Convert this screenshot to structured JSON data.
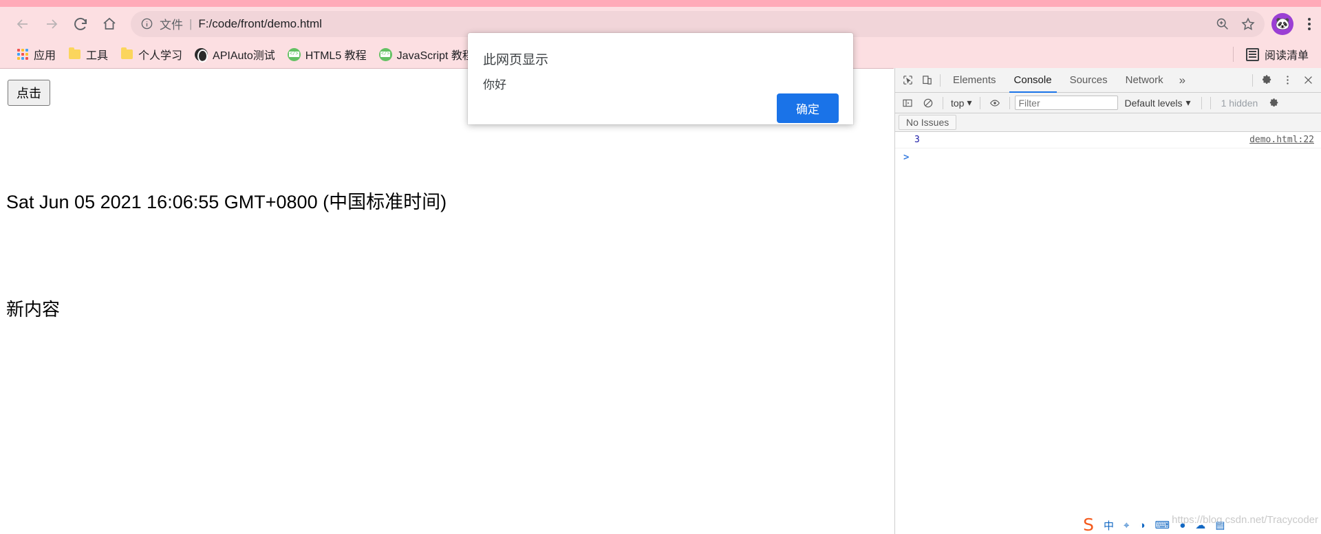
{
  "browser": {
    "nav": {
      "back_icon": "arrow-left-icon",
      "forward_icon": "arrow-right-icon",
      "reload_icon": "reload-icon",
      "home_icon": "home-icon"
    },
    "omnibox": {
      "info_icon": "info-circle-icon",
      "scheme_label": "文件",
      "separator": "|",
      "url": "F:/code/front/demo.html",
      "zoom_icon": "zoom-in-icon",
      "bookmark_icon": "star-icon"
    },
    "profile": {
      "avatar_icon": "panda-avatar",
      "avatar_glyph": "🐼",
      "color": "#9b3fd4"
    },
    "menu_icon": "kebab-menu-icon"
  },
  "bookmarks": {
    "items": [
      {
        "label": "应用",
        "icon": "apps-grid-icon"
      },
      {
        "label": "工具",
        "icon": "folder-icon"
      },
      {
        "label": "个人学习",
        "icon": "folder-icon"
      },
      {
        "label": "APIAuto测试",
        "icon": "globe-icon"
      },
      {
        "label": "HTML5 教程",
        "icon": "code-page-icon"
      },
      {
        "label": "JavaScript 教程",
        "icon": "code-page-icon"
      }
    ],
    "reading_list": {
      "label": "阅读清单",
      "icon": "reading-list-icon"
    }
  },
  "page": {
    "button_label": "点击",
    "date_text": "Sat Jun 05 2021 16:06:55 GMT+0800 (中国标准时间)",
    "new_content": "新内容"
  },
  "dialog": {
    "title": "此网页显示",
    "message": "你好",
    "ok_label": "确定",
    "accent_color": "#1a73e8"
  },
  "devtools": {
    "inspect_icon": "inspect-element-icon",
    "device_icon": "device-toolbar-icon",
    "tabs": [
      {
        "label": "Elements",
        "active": false
      },
      {
        "label": "Console",
        "active": true
      },
      {
        "label": "Sources",
        "active": false
      },
      {
        "label": "Network",
        "active": false
      }
    ],
    "more_tabs_icon": "chevron-double-right-icon",
    "settings_icon": "gear-icon",
    "dots_icon": "kebab-menu-icon",
    "close_icon": "close-icon",
    "console_toolbar": {
      "sidebar_icon": "console-sidebar-icon",
      "clear_icon": "clear-console-icon",
      "context": "top",
      "context_caret": "▾",
      "eye_icon": "live-expression-icon",
      "filter_placeholder": "Filter",
      "filter_value": "",
      "levels_label": "Default levels",
      "levels_caret": "▾",
      "hidden_label": "1 hidden",
      "settings_icon": "gear-icon"
    },
    "issues_button": "No Issues",
    "log_entries": [
      {
        "value": "3",
        "source": "demo.html:22"
      }
    ],
    "prompt_caret": ">",
    "prompt_value": ""
  },
  "ime": {
    "logo": "S",
    "items": [
      "中",
      "⌖",
      "◑",
      "⌨",
      "●",
      "☁",
      "▤"
    ]
  },
  "watermark": "https://blog.csdn.net/Tracycoder"
}
